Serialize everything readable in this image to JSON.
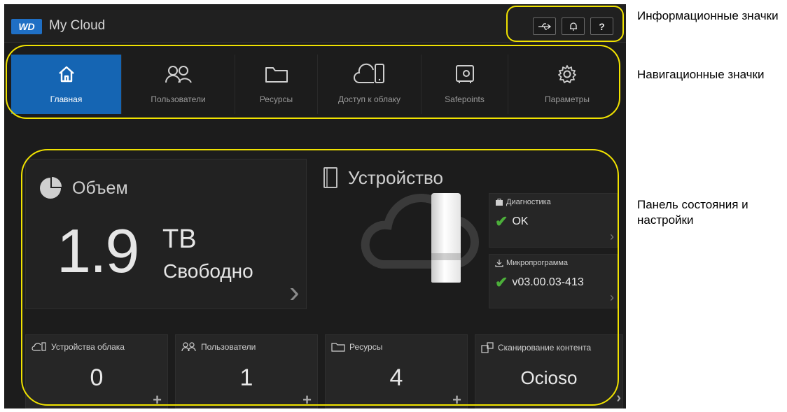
{
  "header": {
    "logo": "WD",
    "title": "My Cloud",
    "info_icons": [
      {
        "name": "usb-icon",
        "glyph": "⇠"
      },
      {
        "name": "bell-icon",
        "glyph": "♫"
      },
      {
        "name": "help-icon",
        "glyph": "?"
      }
    ]
  },
  "nav": {
    "items": [
      {
        "label": "Главная",
        "icon": "home-icon",
        "active": true
      },
      {
        "label": "Пользователи",
        "icon": "users-icon",
        "active": false
      },
      {
        "label": "Ресурсы",
        "icon": "folder-icon",
        "active": false
      },
      {
        "label": "Доступ к облаку",
        "icon": "cloud-device-icon",
        "active": false
      },
      {
        "label": "Safepoints",
        "icon": "safe-icon",
        "active": false
      },
      {
        "label": "Параметры",
        "icon": "gear-icon",
        "active": false
      }
    ]
  },
  "volume": {
    "title": "Объем",
    "value": "1.9",
    "unit": "TB",
    "free_label": "Свободно"
  },
  "device": {
    "title": "Устройство",
    "diagnostics": {
      "label": "Диагностика",
      "value": "OK"
    },
    "firmware": {
      "label": "Микропрограмма",
      "value": "v03.00.03-413"
    }
  },
  "stats": [
    {
      "label": "Устройства облака",
      "value": "0",
      "icon": "cloud-device-icon"
    },
    {
      "label": "Пользователи",
      "value": "1",
      "icon": "users-icon"
    },
    {
      "label": "Ресурсы",
      "value": "4",
      "icon": "folder-icon"
    },
    {
      "label": "Сканирование контента",
      "value": "Ocioso",
      "icon": "scan-icon"
    }
  ],
  "annotations": {
    "info": "Информационные значки",
    "nav": "Навигационные значки",
    "status": "Панель состояния и настройки"
  },
  "colors": {
    "accent": "#1565b3",
    "callout": "#f0e200",
    "ok": "#4caf3a"
  }
}
